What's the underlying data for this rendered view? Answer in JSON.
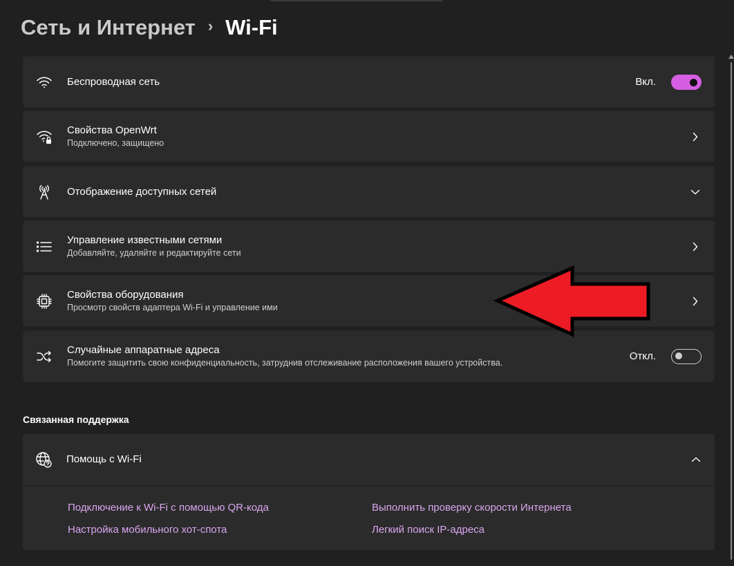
{
  "header": {
    "parent": "Сеть и Интернет",
    "separator": "›",
    "current": "Wi-Fi"
  },
  "settings": [
    {
      "icon": "wifi-icon",
      "title": "Беспроводная сеть",
      "toggle_label": "Вкл.",
      "toggle_state": "on"
    },
    {
      "icon": "wifi-lock-icon",
      "title": "Свойства OpenWrt",
      "subtitle": "Подключено, защищено"
    },
    {
      "icon": "antenna-icon",
      "title": "Отображение доступных сетей"
    },
    {
      "icon": "list-icon",
      "title": "Управление известными сетями",
      "subtitle": "Добавляйте, удаляйте и редактируйте сети"
    },
    {
      "icon": "chip-icon",
      "title": "Свойства оборудования",
      "subtitle": "Просмотр свойств адаптера Wi-Fi и управление ими"
    },
    {
      "icon": "shuffle-icon",
      "title": "Случайные аппаратные адреса",
      "subtitle": "Помогите защитить свою конфиденциальность, затруднив отслеживание расположения вашего устройства.",
      "toggle_label": "Откл.",
      "toggle_state": "off"
    }
  ],
  "support": {
    "section_title": "Связанная поддержка",
    "help_title": "Помощь с Wi-Fi",
    "links": [
      "Подключение к Wi-Fi с помощью QR-кода",
      "Выполнить проверку скорости Интернета",
      "Настройка мобильного хот-спота",
      "Легкий поиск IP-адреса"
    ]
  },
  "colors": {
    "background": "#202020",
    "card": "#2b2b2b",
    "accent": "#d65ee3",
    "link": "#d9a6f0",
    "annotation_arrow": "#ed1c24"
  }
}
